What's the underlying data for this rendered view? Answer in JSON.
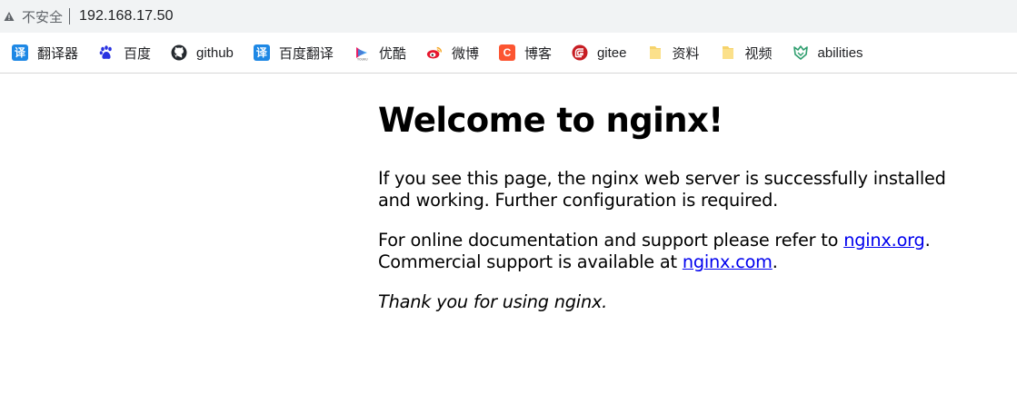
{
  "omnibox": {
    "security_label": "不安全",
    "url": "192.168.17.50"
  },
  "bookmarks": [
    {
      "label": "翻译器",
      "icon": "translate-icon",
      "color": "#1e88e5",
      "glyph": "译"
    },
    {
      "label": "百度",
      "icon": "baidu-paw-icon",
      "color": "#2932e1"
    },
    {
      "label": "github",
      "icon": "github-icon",
      "color": "#24292e"
    },
    {
      "label": "百度翻译",
      "icon": "translate-icon",
      "color": "#1e88e5",
      "glyph": "译"
    },
    {
      "label": "优酷",
      "icon": "youku-icon",
      "color": "#e91e63"
    },
    {
      "label": "微博",
      "icon": "weibo-icon",
      "color": "#e6162d"
    },
    {
      "label": "博客",
      "icon": "csdn-icon",
      "color": "#fc5531",
      "glyph": "C"
    },
    {
      "label": "gitee",
      "icon": "gitee-icon",
      "color": "#c71d23",
      "glyph": "G"
    },
    {
      "label": "资料",
      "icon": "folder-icon",
      "color": "#f6d36b"
    },
    {
      "label": "视频",
      "icon": "folder-icon",
      "color": "#f6d36b"
    },
    {
      "label": "abilities",
      "icon": "abilities-icon",
      "color": "#2e9e6e"
    }
  ],
  "page": {
    "heading": "Welcome to nginx!",
    "para1": "If you see this page, the nginx web server is successfully installed and working. Further configuration is required.",
    "para2_before": "For online documentation and support please refer to ",
    "link1": "nginx.org",
    "para2_mid": ".",
    "para2_line2": "Commercial support is available at ",
    "link2": "nginx.com",
    "para2_end": ".",
    "thanks": "Thank you for using nginx."
  }
}
